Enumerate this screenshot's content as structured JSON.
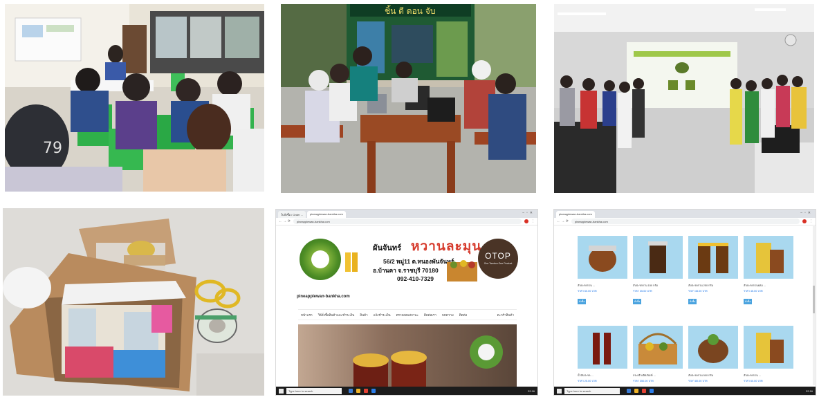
{
  "photos": [
    {
      "id": "t1",
      "kind": "photo"
    },
    {
      "id": "t2",
      "kind": "photo",
      "wall_sign": "ชิ้น ดี ดอน จับ"
    },
    {
      "id": "t3",
      "kind": "photo"
    },
    {
      "id": "t4",
      "kind": "photo"
    }
  ],
  "site": {
    "tabs": [
      "ใบสั่งซื้อ / Order ...",
      "pineapplewan-bankha.com"
    ],
    "url": "pineapplewan-bankha.com",
    "shop_name_small": "ผันจันทร์",
    "shop_name_big": "หวานละมุน",
    "address_line1": "56/2 หมู่11 ต.หนองพันจันทร์",
    "address_line2": "อ.บ้านคา จ.ราชบุรี 70180",
    "phone": "092-410-7329",
    "otop_logo": "OTOP",
    "otop_tagline": "One Tambon One Product",
    "domain": "pineapplewan-bankha.com",
    "menu": [
      "หน้าแรก",
      "วิธีสั่งซื้อสินค้าและชำระเงิน",
      "สินค้า",
      "แจ้งชำระเงิน",
      "ตรวจสอบสถานะ",
      "ติดต่อเรา",
      "บทความ",
      "ติดต่อ"
    ],
    "cart": "ตะกร้าสินค้า",
    "taskbar_search": "Type here to search",
    "time": "22:16"
  },
  "products_page": {
    "tabs": [
      "pineapplewan-bankha.com"
    ],
    "url": "pineapplewan-bankha.com",
    "taskbar_search": "Type here to search",
    "time": "22:16",
    "items": [
      {
        "name": "สับปะรดกวน ...",
        "price": "ราคา 60.00 บาท",
        "btn": "สั่งซื้อ"
      },
      {
        "name": "สับปะรดกวน 150 กรัม",
        "price": "ราคา 35.00 บาท",
        "btn": "สั่งซื้อ"
      },
      {
        "name": "สับปะรดกวน 250 กรัม",
        "price": "ราคา 45.00 บาท",
        "btn": "สั่งซื้อ"
      },
      {
        "name": "สับปะรดกวนผสม ...",
        "price": "ราคา 45.00 บาท",
        "btn": "สั่งซื้อ"
      },
      {
        "name": "น้ำสับปะรด ...",
        "price": "ราคา 25.00 บาท",
        "btn": "สั่งซื้อ"
      },
      {
        "name": "กระเช้าผลิตภัณฑ์ ...",
        "price": "ราคา 350.00 บาท",
        "btn": "สั่งซื้อ"
      },
      {
        "name": "สับปะรดกวน 500 กรัม",
        "price": "ราคา 80.00 บาท",
        "btn": "สั่งซื้อ"
      },
      {
        "name": "สับปะรดกวน ...",
        "price": "ราคา 60.00 บาท",
        "btn": "สั่งซื้อ"
      }
    ]
  },
  "colors": {
    "accent_red": "#d63b2d",
    "otop_brown": "#4a3426",
    "link_blue": "#1a73e8",
    "button_blue": "#4aa3df"
  }
}
